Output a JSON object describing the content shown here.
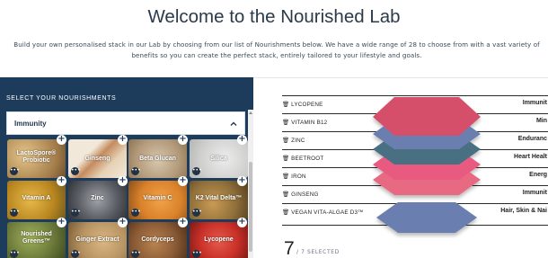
{
  "header": {
    "title": "Welcome to the Nourished Lab",
    "intro_line1": "Build your own personalised stack in our Lab by choosing from our list of Nourishments below. We have a wide range of 28 to choose from with a vast variety of",
    "intro_line2": "benefits so you can create the perfect stack, entirely tailored to your lifestyle and goals."
  },
  "selector": {
    "label": "SELECT YOUR NOURISHMENTS",
    "category_value": "Immunity"
  },
  "tiles": [
    {
      "label": "LactoSpore® Probiotic",
      "color": "#c9a46a"
    },
    {
      "label": "Ginseng",
      "color": "#c48b5e"
    },
    {
      "label": "Beta Glucan",
      "color": "#b7a288"
    },
    {
      "label": "Silica",
      "color": "#d2d3d1"
    },
    {
      "label": "Vitamin A",
      "color": "#c99a2f"
    },
    {
      "label": "Zinc",
      "color": "#5c6066"
    },
    {
      "label": "Vitamin C",
      "color": "#d9822b"
    },
    {
      "label": "K2 Vital Delta™",
      "color": "#8f6f3a"
    },
    {
      "label": "Nourished Greens™",
      "color": "#6b7a3a"
    },
    {
      "label": "Ginger Extract",
      "color": "#b79362"
    },
    {
      "label": "Cordyceps",
      "color": "#8a5a35"
    },
    {
      "label": "Lycopene",
      "color": "#c83028"
    }
  ],
  "stack_list": [
    {
      "name": "LYCOPENE",
      "benefit": "Immunit"
    },
    {
      "name": "VITAMIN B12",
      "benefit": "Min"
    },
    {
      "name": "ZINC",
      "benefit": "Enduranc"
    },
    {
      "name": "BEETROOT",
      "benefit": "Heart Healt"
    },
    {
      "name": "IRON",
      "benefit": "Energ"
    },
    {
      "name": "GINSENG",
      "benefit": "Immunit"
    },
    {
      "name": "VEGAN VITA-ALGAE D3™",
      "benefit": "Hair, Skin & Nai"
    }
  ],
  "layers": [
    {
      "color": "#d6506a"
    },
    {
      "color": "#6a7fb0"
    },
    {
      "color": "#4a6f82"
    },
    {
      "color": "#e85a7f"
    },
    {
      "color": "#e86a82"
    },
    {
      "color": "#6a7fb0"
    }
  ],
  "selected": {
    "count": "7",
    "total_text": "/ 7 SELECTED"
  }
}
